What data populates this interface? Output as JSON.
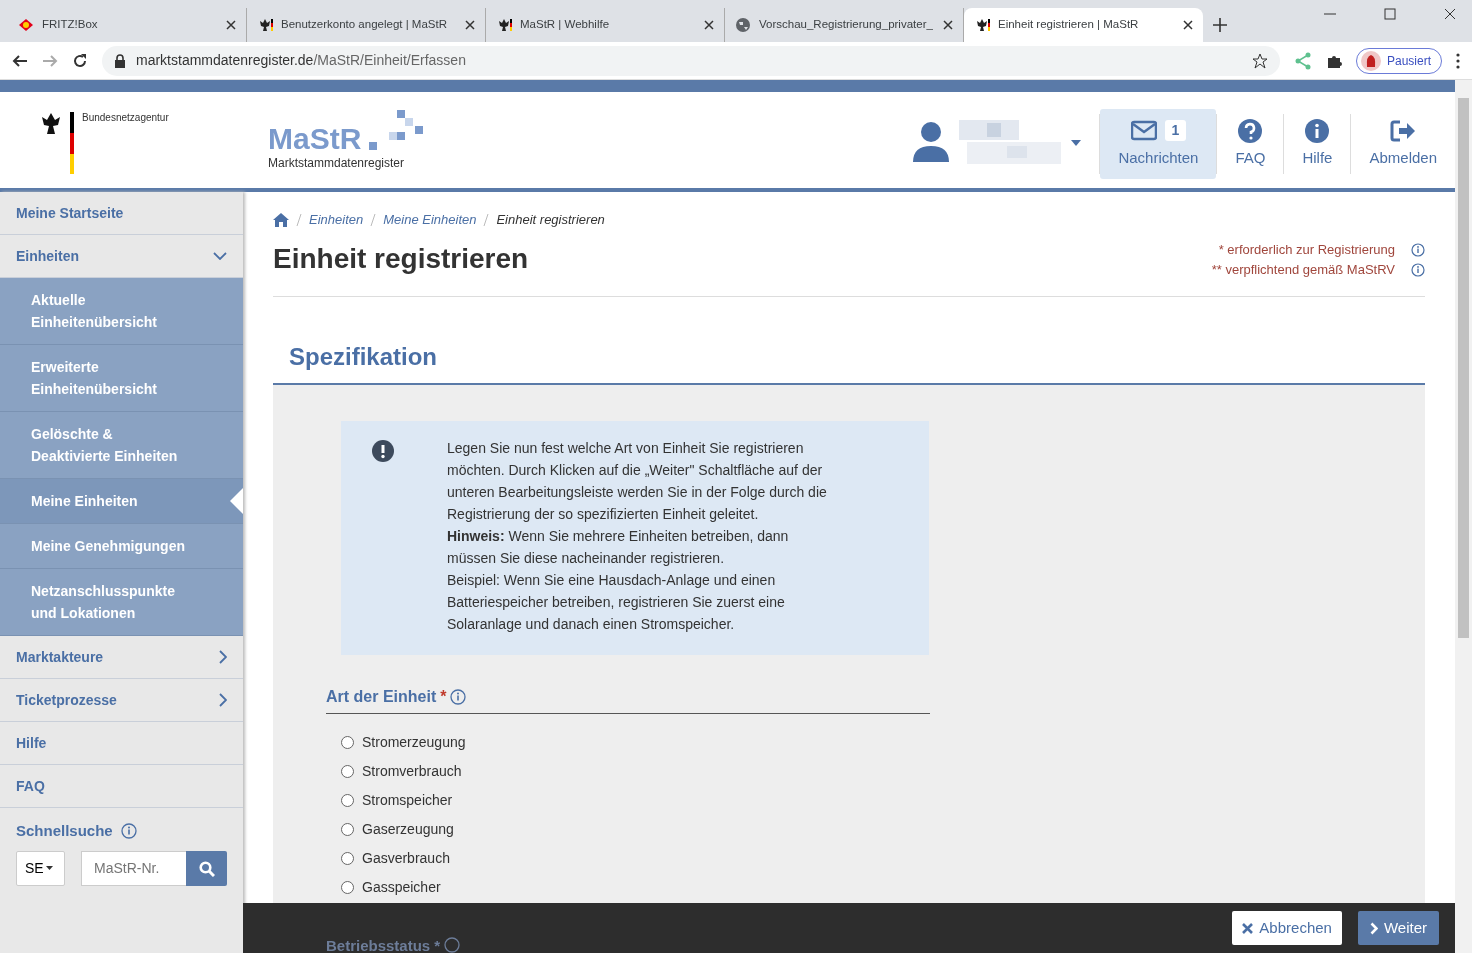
{
  "browser": {
    "tabs": [
      {
        "title": "FRITZ!Box",
        "selected": false
      },
      {
        "title": "Benutzerkonto angelegt | MaStR",
        "selected": false
      },
      {
        "title": "MaStR | Webhilfe",
        "selected": false
      },
      {
        "title": "Vorschau_Registrierung_privater_",
        "selected": false
      },
      {
        "title": "Einheit registrieren | MaStR",
        "selected": true
      }
    ],
    "url_host": "marktstammdatenregister.de",
    "url_path": "/MaStR/Einheit/Erfassen",
    "profile": "Pausiert"
  },
  "header": {
    "agency": "Bundesnetzagentur",
    "logo": "MaStR",
    "logo_subtitle": "Marktstammdatenregister",
    "nav": [
      {
        "label": "Nachrichten",
        "badge": "1",
        "kind": "mail",
        "selected": true
      },
      {
        "label": "FAQ",
        "kind": "question",
        "selected": false
      },
      {
        "label": "Hilfe",
        "kind": "info",
        "selected": false
      },
      {
        "label": "Abmelden",
        "kind": "logout",
        "selected": false
      }
    ]
  },
  "sidebar": {
    "items": [
      {
        "label": "Meine Startseite",
        "kind": "link"
      },
      {
        "label": "Einheiten",
        "kind": "group",
        "expanded": true,
        "children": [
          {
            "label": "Aktuelle Einheitenübersicht",
            "selected": false
          },
          {
            "label": "Erweiterte Einheitenübersicht",
            "selected": false
          },
          {
            "label": "Gelöschte & Deaktivierte Einheiten",
            "selected": false
          },
          {
            "label": "Meine Einheiten",
            "selected": true
          },
          {
            "label": "Meine Genehmigungen",
            "selected": false
          },
          {
            "label": "Netzanschlusspunkte und Lokationen",
            "selected": false
          }
        ]
      },
      {
        "label": "Marktakteure",
        "kind": "group",
        "expanded": false
      },
      {
        "label": "Ticketprozesse",
        "kind": "group",
        "expanded": false
      },
      {
        "label": "Hilfe",
        "kind": "link"
      },
      {
        "label": "FAQ",
        "kind": "link"
      }
    ],
    "quick_search": {
      "label": "Schnellsuche",
      "select": "SE",
      "placeholder": "MaStR-Nr."
    }
  },
  "main": {
    "breadcrumb": [
      "Einheiten",
      "Meine Einheiten",
      "Einheit registrieren"
    ],
    "title": "Einheit registrieren",
    "legend": [
      "* erforderlich zur Registrierung",
      "** verpflichtend gemäß MaStRV"
    ],
    "section": "Spezifikation",
    "info": [
      "Legen Sie nun fest welche Art von Einheit Sie registrieren möchten. Durch Klicken auf die „Weiter\" Schaltfläche auf der unteren Bearbeitungsleiste werden Sie in der Folge durch die Registrierung der so spezifizierten Einheit geleitet.",
      "**Hinweis:** Wenn Sie mehrere Einheiten betreiben, dann müssen Sie diese nacheinander registrieren.",
      "Beispiel: Wenn Sie eine Hausdach-Anlage und einen Batteriespeicher betreiben, registrieren Sie zuerst eine Solaranlage und danach einen Stromspeicher."
    ],
    "field": {
      "label": "Art der Einheit",
      "required": "*",
      "options": [
        {
          "label": "Stromerzeugung",
          "selected": false
        },
        {
          "label": "Stromverbrauch",
          "selected": false
        },
        {
          "label": "Stromspeicher",
          "selected": false
        },
        {
          "label": "Gaserzeugung",
          "selected": false
        },
        {
          "label": "Gasverbrauch",
          "selected": false
        },
        {
          "label": "Gasspeicher",
          "selected": false
        }
      ]
    },
    "next_field": {
      "label": "Betriebsstatus",
      "required": "*"
    }
  },
  "actions": {
    "cancel": "Abbrechen",
    "next": "Weiter"
  }
}
